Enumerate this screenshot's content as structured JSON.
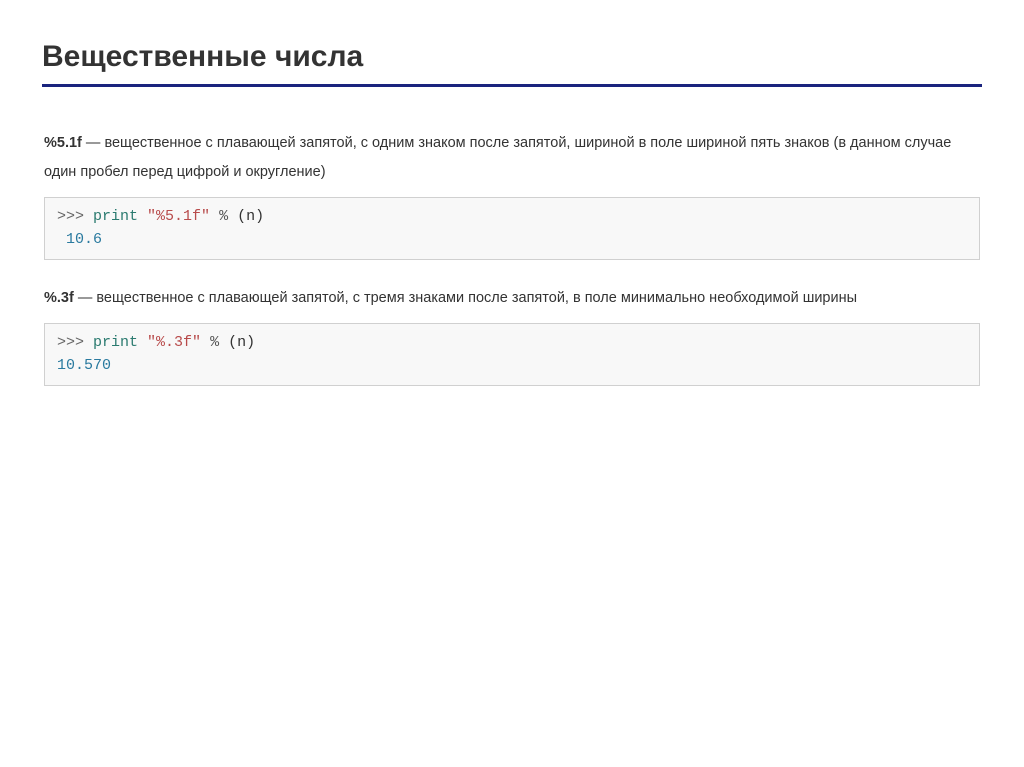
{
  "title": "Вещественные числа",
  "sections": [
    {
      "format_spec": "%5.1f",
      "desc_rest": " — вещественное с плавающей запятой, с одним знаком после запятой, шириной в поле шириной пять знаков (в данном случае один пробел перед цифрой и округление)",
      "code": {
        "prompt": ">>> ",
        "keyword": "print",
        "string": "\"%5.1f\"",
        "operator": " % ",
        "args": "(n)",
        "output": " 10.6"
      }
    },
    {
      "format_spec": "%.3f",
      "desc_rest": " — вещественное с плавающей запятой, с тремя знаками после запятой, в поле минимально необходимой ширины",
      "code": {
        "prompt": ">>> ",
        "keyword": "print",
        "string": "\"%.3f\"",
        "operator": " % ",
        "args": "(n)",
        "output": "10.570"
      }
    }
  ]
}
